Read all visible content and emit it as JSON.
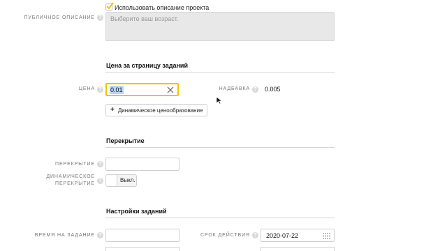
{
  "project": {
    "use_description_label": "Использовать описание проекта",
    "use_description_checked": true,
    "public_description_label": "ПУБЛИЧНОЕ ОПИСАНИЕ",
    "public_description_placeholder": "Выберите ваш возраст."
  },
  "price_section": {
    "title": "Цена за страницу заданий",
    "price_label": "ЦЕНА",
    "price_value": "0.01",
    "markup_label": "НАДБАВКА",
    "markup_value": "0.005",
    "dynamic_pricing_button": "Динамическое ценообразование"
  },
  "overlap_section": {
    "title": "Перекрытие",
    "overlap_label": "ПЕРЕКРЫТИЕ",
    "overlap_value": "",
    "dynamic_overlap_label_1": "ДИНАМИЧЕСКОЕ",
    "dynamic_overlap_label_2": "ПЕРЕКРЫТИЕ",
    "dynamic_overlap_toggle": "Выкл."
  },
  "task_settings": {
    "title": "Настройки заданий",
    "time_per_task_label": "ВРЕМЯ НА ЗАДАНИЕ",
    "time_per_task_value": "",
    "validity_label": "СРОК ДЕЙСТВИЯ",
    "validity_value": "2020-07-22"
  },
  "colors": {
    "accent_yellow": "#f2c200",
    "selection_blue": "#b9d4f5",
    "textarea_bg": "#e8e8e8"
  }
}
